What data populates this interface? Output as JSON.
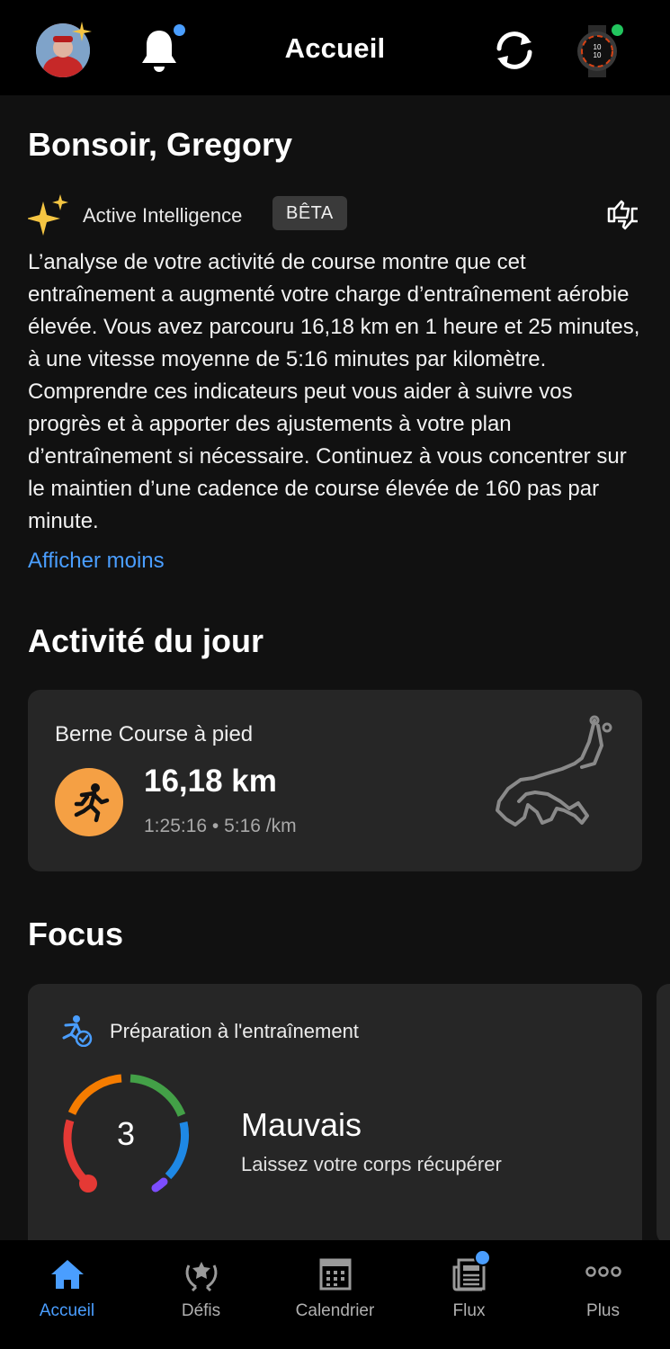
{
  "header": {
    "title": "Accueil",
    "icons": [
      "avatar",
      "bell-icon",
      "sync-icon",
      "watch-icon"
    ]
  },
  "greeting": "Bonsoir, Gregory",
  "ai": {
    "label": "Active Intelligence",
    "badge": "BÊTA",
    "summary": "L’analyse de votre activité de course montre que cet entraînement a augmenté votre charge d’entraînement aérobie élevée. Vous avez parcouru 16,18 km en 1 heure et 25 minutes, à une vitesse moyenne de 5:16 minutes par kilomètre. Comprendre ces indicateurs peut vous aider à suivre vos progrès et à apporter des ajustements à votre plan d’entraînement si nécessaire. Continuez à vous concentrer sur le maintien d’une cadence de course élevée de 160 pas par minute.",
    "toggle_label": "Afficher moins"
  },
  "activity_section": {
    "title": "Activité du jour",
    "card": {
      "name": "Berne Course à pied",
      "distance": "16,18 km",
      "meta": "1:25:16 • 5:16 /km"
    }
  },
  "focus_section": {
    "title": "Focus",
    "card": {
      "label": "Préparation à l'entraînement",
      "score": "3",
      "score_max": 100,
      "status": "Mauvais",
      "status_sub": "Laissez votre corps récupérer"
    }
  },
  "tabs": [
    {
      "label": "Accueil",
      "active": true
    },
    {
      "label": "Défis",
      "active": false
    },
    {
      "label": "Calendrier",
      "active": false
    },
    {
      "label": "Flux",
      "active": false,
      "badge": true
    },
    {
      "label": "Plus",
      "active": false
    }
  ],
  "colors": {
    "accent": "#4a9eff",
    "run_orange": "#f5a044",
    "gauge": [
      "#e53935",
      "#f57c00",
      "#43a047",
      "#1e88e5",
      "#7c4dff"
    ]
  }
}
